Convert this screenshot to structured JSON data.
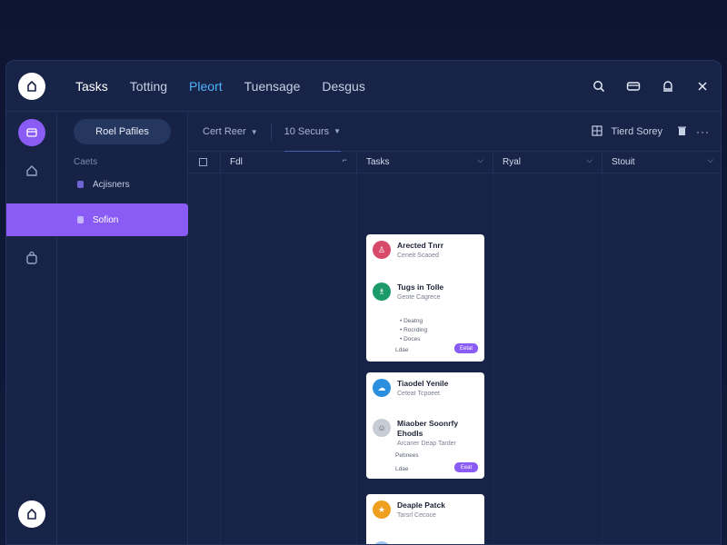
{
  "header": {
    "tabs": [
      "Tasks",
      "Totting",
      "Pleort",
      "Tuensage",
      "Desgus"
    ],
    "active_tab": 2
  },
  "sidebar": {
    "primary_button": "Roel Pafiles",
    "section_label": "Caets",
    "items": [
      {
        "label": "Acjisners"
      },
      {
        "label": "Sofion"
      }
    ]
  },
  "toolbar": {
    "filter1": "Cert Reer",
    "filter2": "10 Securs",
    "right_label": "Tierd Sorey"
  },
  "columns": [
    {
      "label": "Fdl"
    },
    {
      "label": "Tasks"
    },
    {
      "label": "Ryal"
    },
    {
      "label": "Stouit"
    }
  ],
  "cards": [
    {
      "entries": [
        {
          "title": "Arected Tnrr",
          "sub": "Ceneit Scaoed",
          "color": "#d84a6a",
          "icon": "people-icon"
        },
        {
          "title": "Tugs in Tolle",
          "sub": "Geote Cagrece",
          "color": "#1c9a6a",
          "icon": "person-icon"
        }
      ],
      "bullets": [
        "Deatng",
        "Rocrding",
        "Doces"
      ],
      "footer": "Ldae",
      "tag": "Eetat"
    },
    {
      "entries": [
        {
          "title": "Tiaodel Yenile",
          "sub": "Ceteat Tcpoeet",
          "color": "#2b8fe0",
          "icon": "chat-icon"
        },
        {
          "title": "Miaober Soonrfy Ehodls",
          "sub": "Arcaner Deap Tarder",
          "color": "#c8ccd6",
          "icon": "avatar-icon"
        }
      ],
      "line2": "Pebnees",
      "footer": "Ldae",
      "tag": "Eeat"
    },
    {
      "entries": [
        {
          "title": "Deaple Patck",
          "sub": "Tarsrl Cecoce",
          "color": "#f0a020",
          "icon": "star-icon"
        }
      ]
    }
  ]
}
